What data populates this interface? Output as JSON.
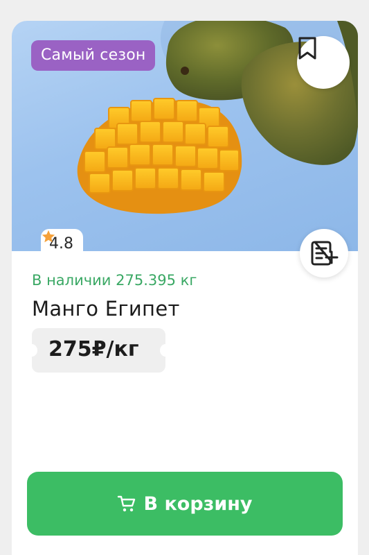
{
  "product": {
    "badge": "Самый сезон",
    "rating": "4.8",
    "stock": "В наличии 275.395 кг",
    "name": "Манго Египет",
    "price": "275₽/кг",
    "add_to_cart_label": "В корзину"
  },
  "colors": {
    "badge_bg": "#9a62c4",
    "stock_text": "#3aa864",
    "cart_button": "#3cbd64",
    "star": "#f5a13a"
  },
  "icons": {
    "bookmark": "bookmark-icon",
    "compare": "list-add-icon",
    "star": "star-icon",
    "cart": "cart-icon"
  }
}
